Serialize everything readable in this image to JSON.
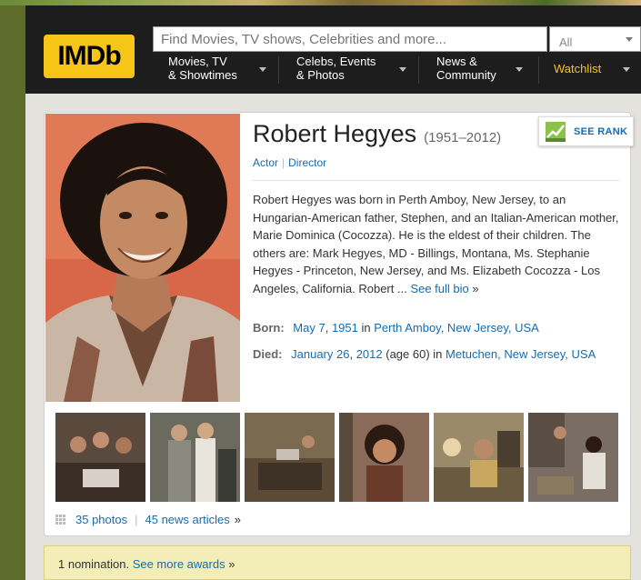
{
  "header": {
    "logo_text": "IMDb",
    "search_placeholder": "Find Movies, TV shows, Celebrities and more...",
    "search_category": "All",
    "nav": [
      {
        "line1": "Movies, TV",
        "line2": "& Showtimes"
      },
      {
        "line1": "Celebs, Events",
        "line2": "& Photos"
      },
      {
        "line1": "News &",
        "line2": "Community"
      }
    ],
    "watchlist": "Watchlist"
  },
  "person": {
    "name": "Robert Hegyes",
    "years": "(1951–2012)",
    "roles": [
      "Actor",
      "Director"
    ],
    "see_rank": "SEE RANK",
    "bio": "Robert Hegyes was born in Perth Amboy, New Jersey, to an Hungarian-American father, Stephen, and an Italian-American mother, Marie Dominica (Cocozza). He is the eldest of their children. The others are: Mark Hegyes, MD - Billings, Montana, Ms. Stephanie Hegyes - Princeton, New Jersey, and Ms. Elizabeth Cocozza - Los Angeles, California. Robert ...",
    "see_full_bio": "See full bio",
    "bio_arrow": "»",
    "born": {
      "label": "Born:",
      "date_day": "May 7",
      "date_sep": ",",
      "year": "1951",
      "in": "in",
      "place": "Perth Amboy, New Jersey, USA"
    },
    "died": {
      "label": "Died:",
      "date_day": "January 26",
      "date_sep": ",",
      "year": "2012",
      "age": "(age 60)",
      "in": "in",
      "place": "Metuchen, New Jersey, USA"
    }
  },
  "media": {
    "photos": "35 photos",
    "sep": "|",
    "news": "45 news articles",
    "arrow": "»"
  },
  "awards": {
    "text": "1 nomination.",
    "link": "See more awards",
    "arrow": "»"
  },
  "colors": {
    "link": "#136cb2",
    "imdb_yellow": "#f5c518",
    "header_bg": "#1d1d1d",
    "awards_bg": "#f3eeb8"
  }
}
